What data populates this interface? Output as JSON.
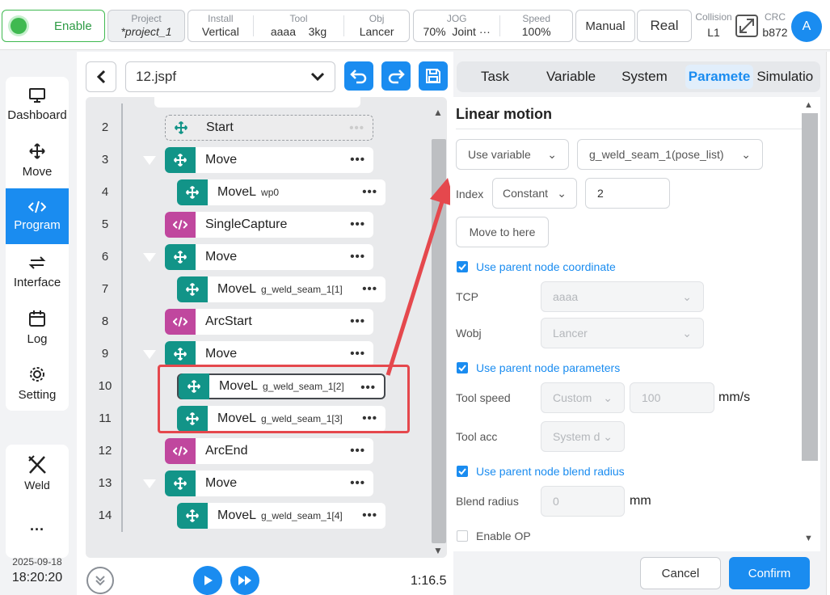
{
  "topbar": {
    "enable_label": "Enable",
    "project": {
      "label": "Project",
      "value": "*project_1"
    },
    "install": {
      "label": "Install",
      "value": "Vertical"
    },
    "tool": {
      "label": "Tool",
      "name": "aaaa",
      "load": "3kg"
    },
    "obj": {
      "label": "Obj",
      "value": "Lancer"
    },
    "jog": {
      "label": "JOG",
      "percent": "70%",
      "mode": "Joint ···"
    },
    "speed": {
      "label": "Speed",
      "value": "100%"
    },
    "mode_button": "Manual",
    "sim_button": "Real",
    "collision": {
      "label": "Collision",
      "value": "L1"
    },
    "crc": {
      "label": "CRC",
      "value": "b872"
    },
    "avatar": "A"
  },
  "sidebar": {
    "items": [
      {
        "label": "Dashboard",
        "icon": "monitor-icon"
      },
      {
        "label": "Move",
        "icon": "move-arrows-icon"
      },
      {
        "label": "Program",
        "icon": "code-icon"
      },
      {
        "label": "Interface",
        "icon": "swap-icon"
      },
      {
        "label": "Log",
        "icon": "calendar-icon"
      },
      {
        "label": "Setting",
        "icon": "gear-icon"
      }
    ],
    "weld_label": "Weld",
    "more_label": "···",
    "date": "2025-09-18",
    "time": "18:20:20"
  },
  "editor": {
    "file_name": "12.jspf",
    "elapsed": "1:16.5",
    "rows": [
      {
        "num": "2",
        "name": "Start",
        "sub": ""
      },
      {
        "num": "3",
        "name": "Move",
        "sub": ""
      },
      {
        "num": "4",
        "name": "MoveL",
        "sub": "wp0"
      },
      {
        "num": "5",
        "name": "SingleCapture",
        "sub": ""
      },
      {
        "num": "6",
        "name": "Move",
        "sub": ""
      },
      {
        "num": "7",
        "name": "MoveL",
        "sub": "g_weld_seam_1[1]"
      },
      {
        "num": "8",
        "name": "ArcStart",
        "sub": ""
      },
      {
        "num": "9",
        "name": "Move",
        "sub": ""
      },
      {
        "num": "10",
        "name": "MoveL",
        "sub": "g_weld_seam_1[2]"
      },
      {
        "num": "11",
        "name": "MoveL",
        "sub": "g_weld_seam_1[3]"
      },
      {
        "num": "12",
        "name": "ArcEnd",
        "sub": ""
      },
      {
        "num": "13",
        "name": "Move",
        "sub": ""
      },
      {
        "num": "14",
        "name": "MoveL",
        "sub": "g_weld_seam_1[4]"
      }
    ],
    "more": "•••"
  },
  "right": {
    "tabs": [
      "Task",
      "Variable",
      "System",
      "Paramete",
      "Simulatio"
    ],
    "active_tab": "Paramete",
    "section_title": "Linear motion",
    "pose_source": "Use variable",
    "pose_variable": "g_weld_seam_1(pose_list)",
    "index_label": "Index",
    "index_type": "Constant",
    "index_value": "2",
    "move_to_here": "Move to here",
    "use_parent_coord": "Use parent node coordinate",
    "tcp_label": "TCP",
    "tcp_value": "aaaa",
    "wobj_label": "Wobj",
    "wobj_value": "Lancer",
    "use_parent_params": "Use parent node parameters",
    "tool_speed_label": "Tool speed",
    "tool_speed_type": "Custom",
    "tool_speed_value": "100",
    "tool_speed_unit": "mm/s",
    "tool_acc_label": "Tool acc",
    "tool_acc_type": "System d",
    "use_parent_blend": "Use parent node blend radius",
    "blend_label": "Blend radius",
    "blend_value": "0",
    "blend_unit": "mm",
    "enable_op": "Enable OP",
    "cancel": "Cancel",
    "confirm": "Confirm"
  },
  "colors": {
    "accent": "#1a8cf0",
    "teal": "#129488",
    "purple": "#c0479e",
    "highlight": "#e5484d",
    "enable": "#3fb950"
  }
}
